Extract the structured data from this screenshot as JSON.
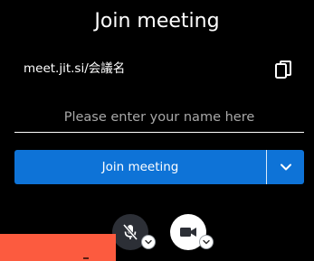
{
  "header": {
    "title": "Join meeting"
  },
  "meeting": {
    "url": "meet.jit.si/会議名",
    "copy_icon": "copy-icon"
  },
  "name_input": {
    "placeholder": "Please enter your name here",
    "value": ""
  },
  "join": {
    "label": "Join meeting",
    "options_icon": "chevron-down-icon"
  },
  "media": {
    "mic_icon": "microphone-muted-icon",
    "camera_icon": "video-camera-icon",
    "mic_options_icon": "chevron-down-icon",
    "camera_options_icon": "chevron-down-icon"
  },
  "colors": {
    "background": "#000000",
    "accent": "#0e73d7",
    "text": "#ffffff",
    "placeholder": "#a8a8a8",
    "mic_button": "#2c2f36",
    "camera_button": "#ffffff",
    "orange_panel": "#fc5b3f"
  }
}
